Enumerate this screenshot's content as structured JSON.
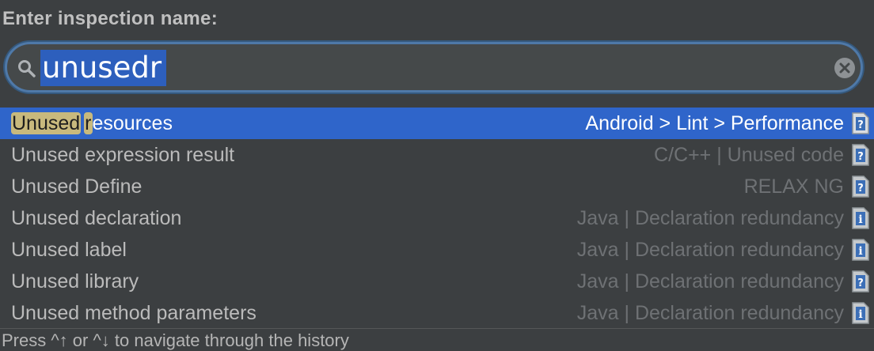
{
  "dialog": {
    "title": "Enter inspection name:"
  },
  "search": {
    "value": "unusedr",
    "icons": {
      "search": "search-icon",
      "clear": "clear-icon"
    }
  },
  "results": [
    {
      "match1": "Unused",
      "match2": "r",
      "rest": "esources",
      "category": "Android > Lint > Performance",
      "icon": "help-doc-icon",
      "selected": true
    },
    {
      "name": "Unused expression result",
      "category": "C/C++ | Unused code",
      "icon": "help-doc-icon"
    },
    {
      "name": "Unused Define",
      "category": "RELAX NG",
      "icon": "help-doc-icon"
    },
    {
      "name": "Unused declaration",
      "category": "Java | Declaration redundancy",
      "icon": "info-doc-icon"
    },
    {
      "name": "Unused label",
      "category": "Java | Declaration redundancy",
      "icon": "info-doc-icon"
    },
    {
      "name": "Unused library",
      "category": "Java | Declaration redundancy",
      "icon": "help-doc-icon"
    },
    {
      "name": "Unused method parameters",
      "category": "Java | Declaration redundancy",
      "icon": "info-doc-icon"
    }
  ],
  "footer": {
    "hint": "Press ^↑ or ^↓ to navigate through the history"
  },
  "colors": {
    "background": "#3c3f41",
    "selection": "#2f65ca",
    "match_highlight": "#c8b97d",
    "focus_ring": "#4f79a8"
  }
}
